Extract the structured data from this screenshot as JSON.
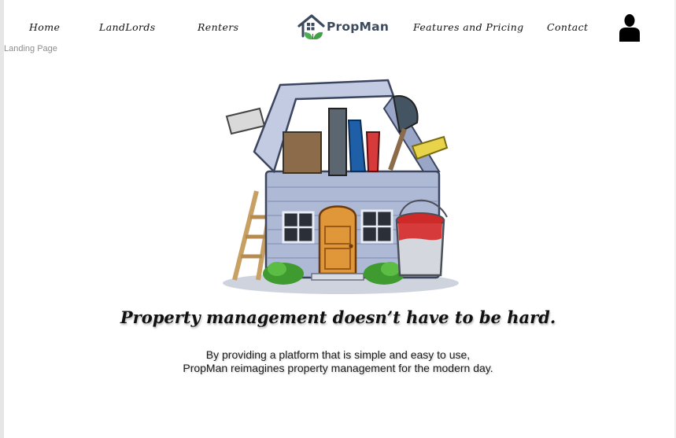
{
  "nav": {
    "home": "Home",
    "landlords": "LandLords",
    "renters": "Renters",
    "features": "Features and Pricing",
    "contact": "Contact"
  },
  "brand": {
    "name": "PropMan",
    "house_icon": "house-icon",
    "leaf_icon": "leaf-icon"
  },
  "user": {
    "icon": "user-icon"
  },
  "page_caption": "Landing Page",
  "hero": {
    "illustration": "house-toolbox-illustration",
    "headline": "Property management doesn’t have to be hard.",
    "subtext_line1": "By providing a platform that is simple and easy to use,",
    "subtext_line2": "PropMan reimagines property management for the modern day."
  },
  "colors": {
    "brand_text": "#3d4a5c",
    "leaf_green": "#4caf50",
    "caption_gray": "#8d8d8d"
  }
}
